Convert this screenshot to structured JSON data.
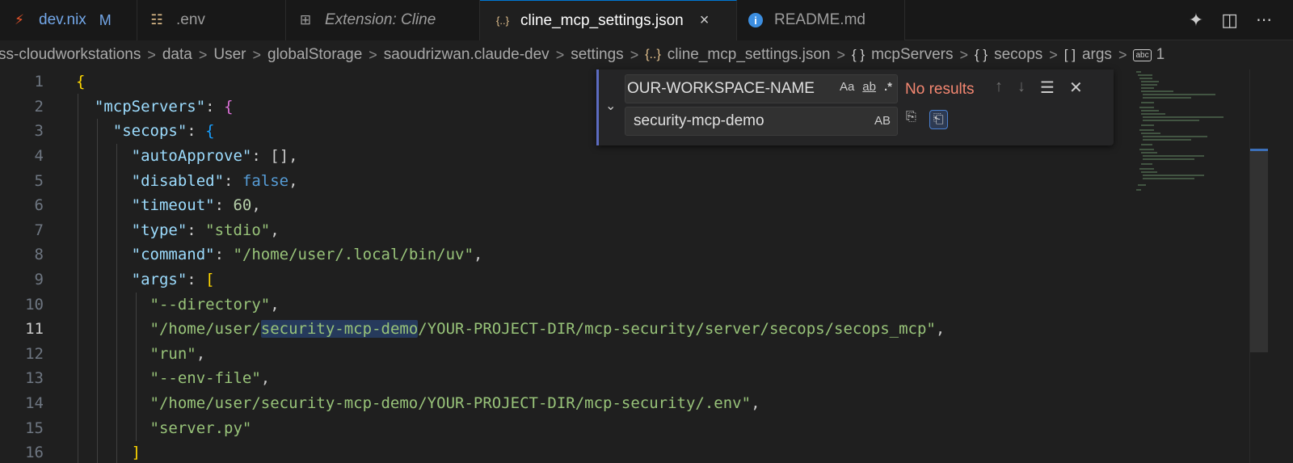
{
  "tabs": [
    {
      "label": "dev.nix",
      "badge": "M",
      "icon": "nix-icon"
    },
    {
      "label": ".env",
      "icon": "settings-sliders-icon"
    },
    {
      "label": "Extension: Cline",
      "icon": "extensions-icon"
    },
    {
      "label": "cline_mcp_settings.json",
      "icon": "json-braces-icon",
      "active": true,
      "close": "×"
    },
    {
      "label": "README.md",
      "icon": "info-icon"
    }
  ],
  "tab_icons": {
    "nix": "⚡",
    "env": "☷",
    "ext": "⊞",
    "json": "{..}",
    "info": "i"
  },
  "tabbar_actions": {
    "sparkle": "✦",
    "split": "◫",
    "more": "⋯"
  },
  "breadcrumb": {
    "items": [
      "ss-cloudworkstations",
      "data",
      "User",
      "globalStorage",
      "saoudrizwan.claude-dev",
      "settings",
      "cline_mcp_settings.json",
      "mcpServers",
      "secops",
      "args",
      "1"
    ],
    "separator": ">",
    "json_icon": "{..}",
    "obj_icon": "{ }",
    "arr_icon": "[ ]",
    "str_icon": "abc"
  },
  "find": {
    "search_value": "OUR-WORKSPACE-NAME",
    "replace_value": "security-mcp-demo",
    "status": "No results",
    "match_case": "Aa",
    "whole_word": "ab",
    "regex": ".*",
    "preserve_case": "AB",
    "toggle": "⌄",
    "prev": "↑",
    "next": "↓",
    "selection": "☰",
    "close": "✕",
    "replace_one": "⎘",
    "replace_all": "⎗"
  },
  "editor": {
    "current_line": 11,
    "lines": [
      {
        "n": "1"
      },
      {
        "n": "2"
      },
      {
        "n": "3"
      },
      {
        "n": "4"
      },
      {
        "n": "5"
      },
      {
        "n": "6"
      },
      {
        "n": "7"
      },
      {
        "n": "8"
      },
      {
        "n": "9"
      },
      {
        "n": "10"
      },
      {
        "n": "11"
      },
      {
        "n": "12"
      },
      {
        "n": "13"
      },
      {
        "n": "14"
      },
      {
        "n": "15"
      },
      {
        "n": "16"
      }
    ],
    "tokens": {
      "l1_brace": "{",
      "l2_key": "\"mcpServers\"",
      "l3_key": "\"secops\"",
      "l4_key": "\"autoApprove\"",
      "l4_val": "[]",
      "l5_key": "\"disabled\"",
      "l5_val": "false",
      "l6_key": "\"timeout\"",
      "l6_val": "60",
      "l7_key": "\"type\"",
      "l7_val": "\"stdio\"",
      "l8_key": "\"command\"",
      "l8_val": "\"/home/user/.local/bin/uv\"",
      "l9_key": "\"args\"",
      "l9_val": "[",
      "l10_val": "\"--directory\"",
      "l11_pre": "\"/home/user/",
      "l11_match": "security-mcp-demo",
      "l11_post": "/YOUR-PROJECT-DIR/mcp-security/server/secops/secops_mcp\"",
      "l12_val": "\"run\"",
      "l13_val": "\"--env-file\"",
      "l14_val": "\"/home/user/security-mcp-demo/YOUR-PROJECT-DIR/mcp-security/.env\"",
      "l15_val": "\"server.py\"",
      "l16_val": "]",
      "colon": ": ",
      "comma": ",",
      "open_brace": "{"
    }
  },
  "colors": {
    "accent": "#0078d4",
    "no_results": "#f48771",
    "match_highlight": "#263a5c"
  }
}
